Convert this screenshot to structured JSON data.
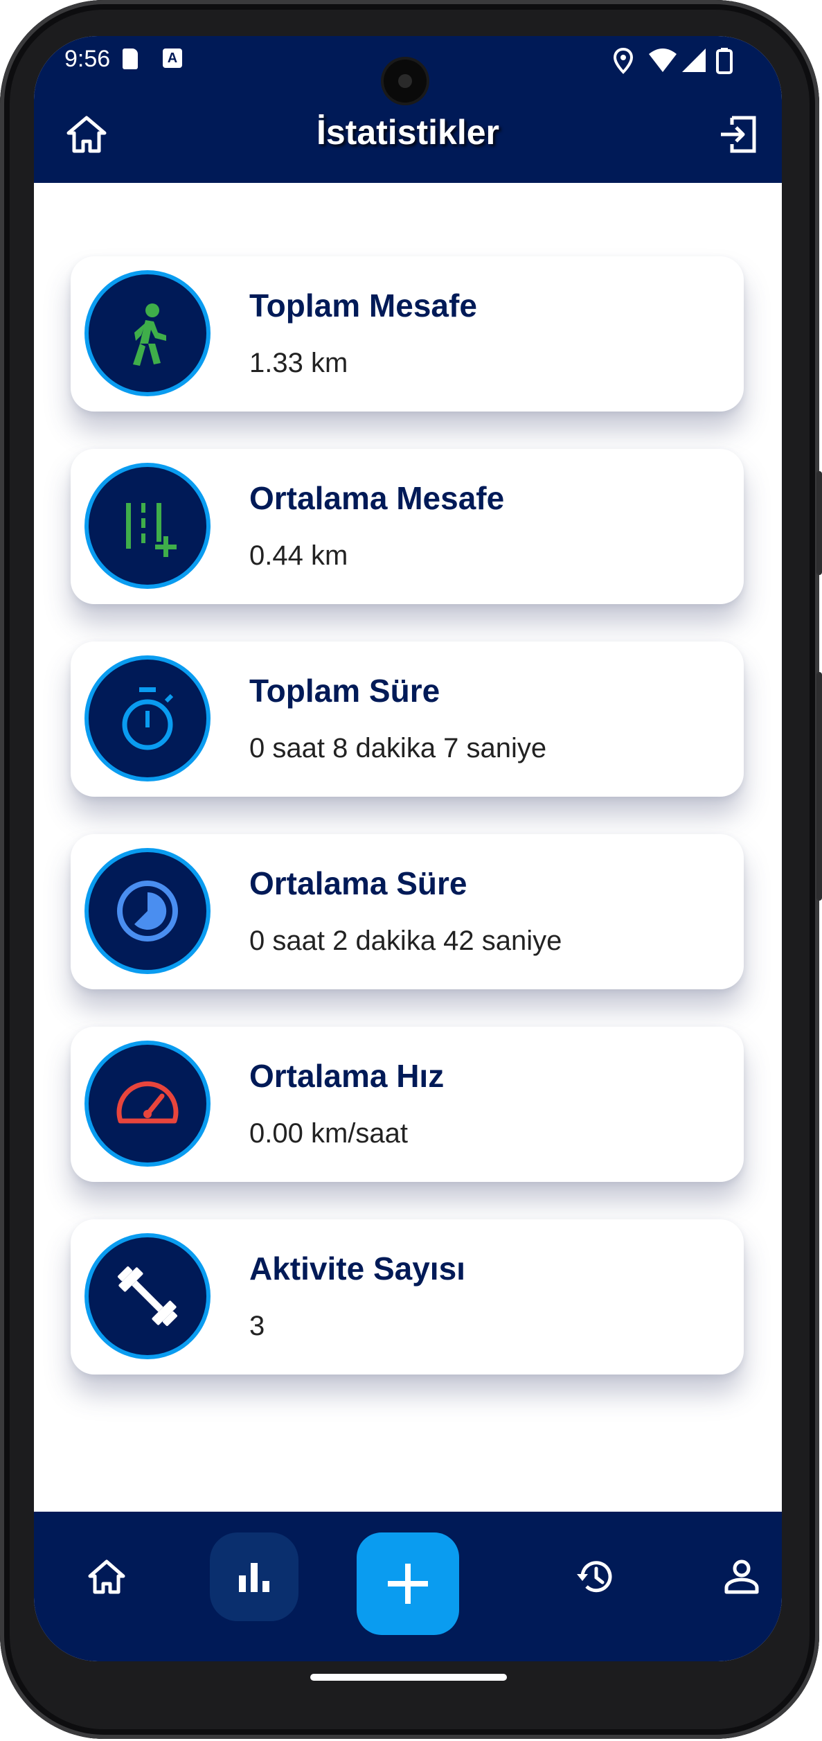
{
  "status_bar": {
    "time": "9:56"
  },
  "app_bar": {
    "title": "İstatistikler",
    "home_icon": "home-icon",
    "logout_icon": "logout-icon"
  },
  "stats": [
    {
      "title": "Toplam Mesafe",
      "value": "1.33 km",
      "icon": "walking-icon",
      "icon_color": "#3fae4a"
    },
    {
      "title": "Ortalama Mesafe",
      "value": "0.44 km",
      "icon": "tally-plus-icon",
      "icon_color": "#3fae4a"
    },
    {
      "title": "Toplam Süre",
      "value": "0 saat 8 dakika 7 saniye",
      "icon": "stopwatch-icon",
      "icon_color": "#0a9cf0"
    },
    {
      "title": "Ortalama Süre",
      "value": "0 saat 2 dakika 42 saniye",
      "icon": "pie-clock-icon",
      "icon_color": "#4a8ef0"
    },
    {
      "title": "Ortalama Hız",
      "value": "0.00 km/saat",
      "icon": "speedometer-icon",
      "icon_color": "#e8453c"
    },
    {
      "title": "Aktivite Sayısı",
      "value": "3",
      "icon": "dumbbell-icon",
      "icon_color": "#ffffff"
    }
  ],
  "bottom_nav": {
    "items": [
      "home-icon",
      "bar-chart-icon",
      "add-icon",
      "history-icon",
      "profile-icon"
    ],
    "active": "bar-chart-icon"
  },
  "colors": {
    "primary": "#001a57",
    "accent": "#0a9cf0"
  }
}
